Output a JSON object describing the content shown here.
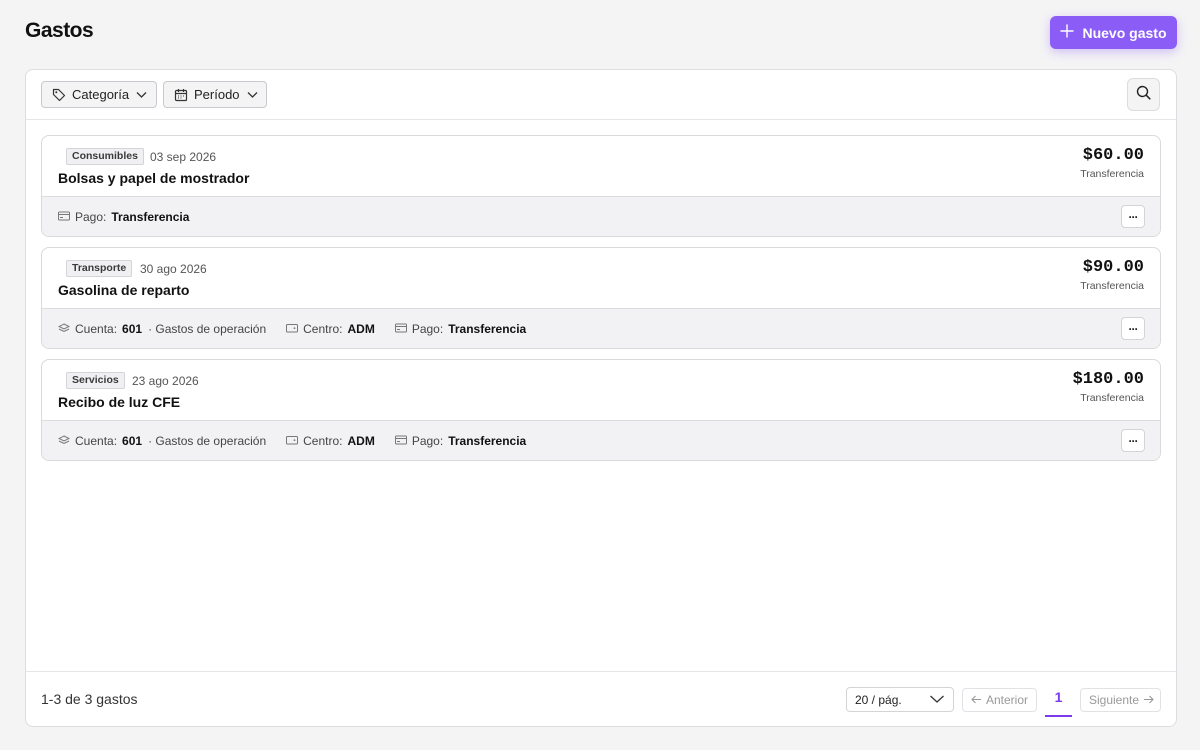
{
  "header": {
    "title": "Gastos",
    "new_button_label": "Nuevo gasto",
    "accent_color": "#8b5cf6"
  },
  "filters": {
    "category_label": "Categoría",
    "period_label": "Período",
    "category_icon": "tag-icon",
    "period_icon": "calendar-icon",
    "search_icon": "search-icon"
  },
  "expenses": [
    {
      "category": "Consumibles",
      "date": "03 sep 2026",
      "description": "Bolsas y papel de mostrador",
      "amount": "$60.00",
      "method": "Transferencia",
      "payment_label": "Pago:",
      "payment_value": "Transferencia"
    },
    {
      "category": "Transporte",
      "date": "30 ago 2026",
      "description": "Gasolina de reparto",
      "amount": "$90.00",
      "method": "Transferencia",
      "account_label": "Cuenta:",
      "account_value": "601",
      "account_note": "· Gastos de operación",
      "center_label": "Centro:",
      "center_value": "ADM",
      "payment_label": "Pago:",
      "payment_value": "Transferencia"
    },
    {
      "category": "Servicios",
      "date": "23 ago 2026",
      "description": "Recibo de luz CFE",
      "amount": "$180.00",
      "method": "Transferencia",
      "account_label": "Cuenta:",
      "account_value": "601",
      "account_note": "· Gastos de operación",
      "center_label": "Centro:",
      "center_value": "ADM",
      "payment_label": "Pago:",
      "payment_value": "Transferencia"
    }
  ],
  "more_label": "···",
  "footer": {
    "count_text": "1-3 de 3 gastos",
    "page_size": "20 / pág.",
    "prev_label": "Anterior",
    "next_label": "Siguiente",
    "current_page": "1"
  }
}
